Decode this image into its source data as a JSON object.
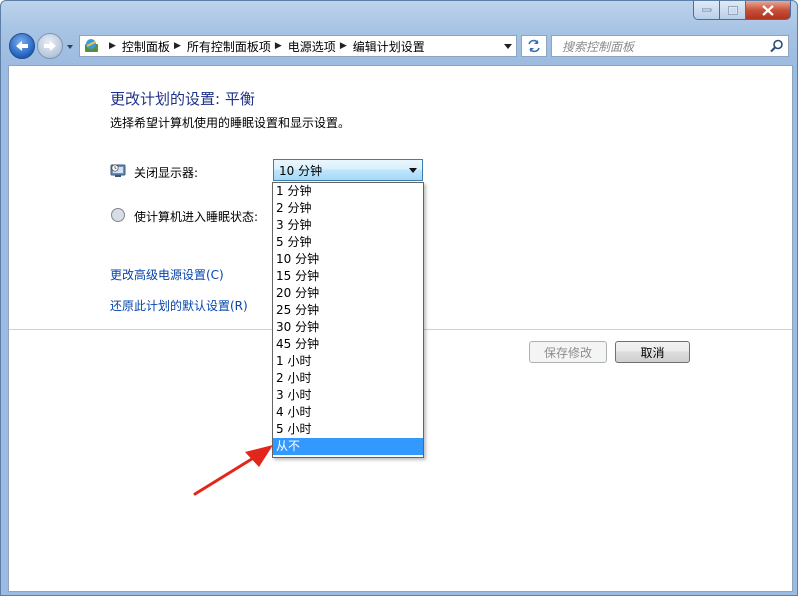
{
  "window": {
    "caption_buttons": [
      "minimize-icon",
      "maximize-icon",
      "close-icon"
    ],
    "close_color": "#c9503a"
  },
  "address_bar": {
    "crumbs": [
      "控制面板",
      "所有控制面板项",
      "电源选项",
      "编辑计划设置"
    ]
  },
  "search": {
    "placeholder": "搜索控制面板"
  },
  "page": {
    "title": "更改计划的设置: 平衡",
    "subtitle": "选择希望计算机使用的睡眠设置和显示设置。",
    "display_off_label": "关闭显示器:",
    "display_off_value": "10 分钟",
    "sleep_label": "使计算机进入睡眠状态:",
    "link_advanced": "更改高级电源设置(C)",
    "link_restore": "还原此计划的默认设置(R)",
    "save_button": "保存修改",
    "cancel_button": "取消"
  },
  "dropdown": {
    "options": [
      "1 分钟",
      "2 分钟",
      "3 分钟",
      "5 分钟",
      "10 分钟",
      "15 分钟",
      "20 分钟",
      "25 分钟",
      "30 分钟",
      "45 分钟",
      "1 小时",
      "2 小时",
      "3 小时",
      "4 小时",
      "5 小时",
      "从不"
    ],
    "highlighted": "从不",
    "highlight_color": "#3399ff"
  },
  "annotation": {
    "arrow_color": "#e3261b"
  },
  "colors": {
    "title": "#1e3287",
    "link": "#0645ad"
  }
}
